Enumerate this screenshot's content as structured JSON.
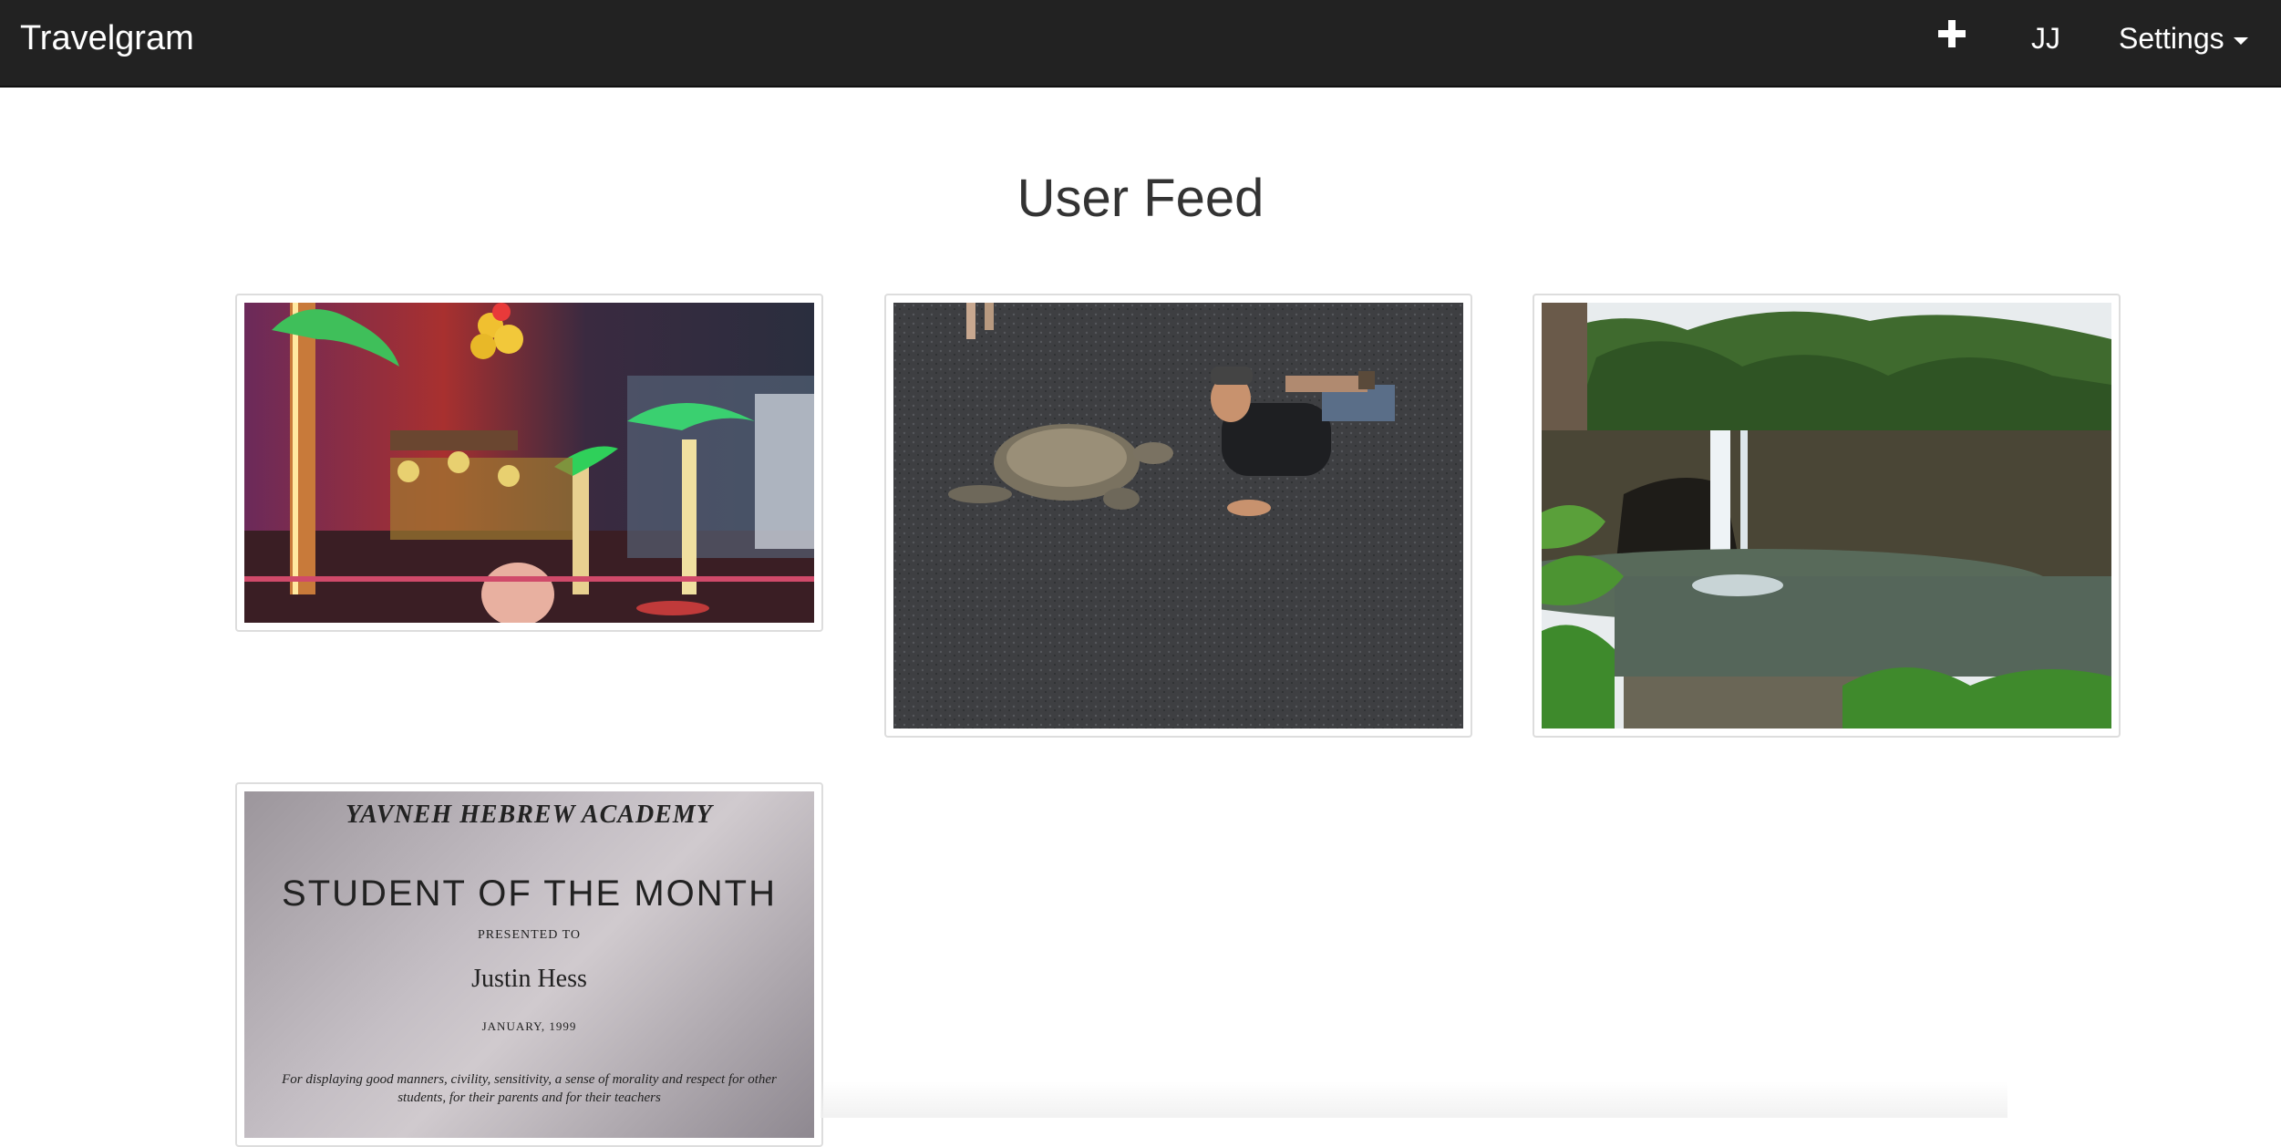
{
  "navbar": {
    "brand": "Travelgram",
    "user_initials": "JJ",
    "settings_label": "Settings",
    "add_icon": "plus-icon"
  },
  "main": {
    "title": "User Feed"
  },
  "feed": {
    "posts": [
      {
        "scene": "nightclub stage with palm lights"
      },
      {
        "scene": "man lying on black sand beach beside sea turtle"
      },
      {
        "scene": "waterfall pouring into jungle pool"
      },
      {
        "certificate": {
          "school": "YAVNEH HEBREW ACADEMY",
          "heading": "STUDENT OF THE MONTH",
          "presented": "PRESENTED TO",
          "name": "Justin Hess",
          "date": "JANUARY, 1999",
          "line1": "For displaying good manners, civility, sensitivity, a sense of morality and respect for other",
          "line2": "students, for their parents and for their teachers"
        }
      }
    ]
  },
  "colors": {
    "navbar_bg": "#222222",
    "thumb_border": "#dddddd"
  }
}
